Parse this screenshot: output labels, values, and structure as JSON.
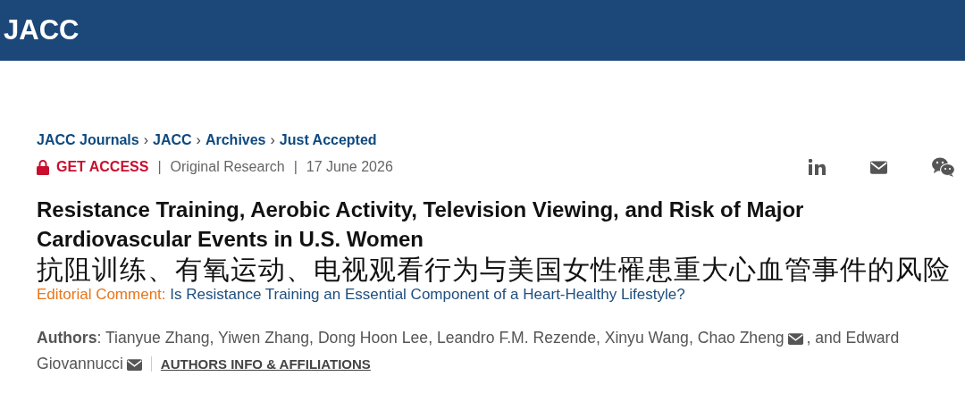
{
  "header": {
    "logo": "JACC"
  },
  "breadcrumbs": [
    {
      "label": "JACC Journals"
    },
    {
      "label": "JACC"
    },
    {
      "label": "Archives"
    },
    {
      "label": "Just Accepted"
    }
  ],
  "breadcrumb_separator": "›",
  "meta": {
    "access": "GET ACCESS",
    "separator": "|",
    "article_type": "Original Research",
    "date": "17 June 2026"
  },
  "share_icons": [
    {
      "kind": "linkedin"
    },
    {
      "kind": "email"
    },
    {
      "kind": "wechat"
    }
  ],
  "title": "Resistance Training, Aerobic Activity, Television Viewing, and Risk of Major Cardiovascular Events in U.S. Women",
  "title_translation": "抗阻训练、有氧运动、电视观看行为与美国女性罹患重大心血管事件的风险",
  "editorial": {
    "label": "Editorial Comment:",
    "link": "Is Resistance Training an Essential Component of a Heart-Healthy Lifestyle?"
  },
  "authors": {
    "label": "Authors",
    "colon": ":",
    "items": [
      {
        "text": "Tianyue Zhang, Yiwen Zhang, Dong Hoon Lee, Leandro F.M. Rezende, Xinyu Wang, Chao Zheng",
        "email": true
      },
      {
        "text": ", and Edward",
        "email": false
      },
      {
        "text": "Giovannucci",
        "email": true
      }
    ],
    "info_link": "AUTHORS INFO & AFFILIATIONS"
  }
}
